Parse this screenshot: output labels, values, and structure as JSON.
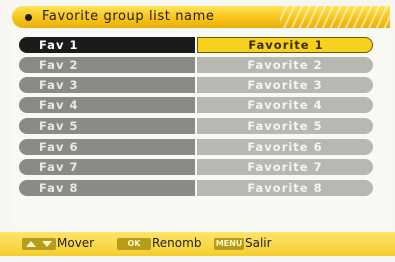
{
  "header": {
    "title": "Favorite group list name"
  },
  "rows": [
    {
      "group": "Fav 1",
      "name": "Favorite 1",
      "selected": true
    },
    {
      "group": "Fav 2",
      "name": "Favorite 2",
      "selected": false
    },
    {
      "group": "Fav 3",
      "name": "Favorite 3",
      "selected": false
    },
    {
      "group": "Fav 4",
      "name": "Favorite 4",
      "selected": false
    },
    {
      "group": "Fav 5",
      "name": "Favorite 5",
      "selected": false
    },
    {
      "group": "Fav 6",
      "name": "Favorite 6",
      "selected": false
    },
    {
      "group": "Fav 7",
      "name": "Favorite 7",
      "selected": false
    },
    {
      "group": "Fav 8",
      "name": "Favorite 8",
      "selected": false
    }
  ],
  "footer": {
    "move_key": "arrow-up-down-icon",
    "move_label": "Mover",
    "ok_key": "OK",
    "ok_label": "Renomb",
    "menu_key": "MENU",
    "menu_label": "Salir"
  },
  "colors": {
    "accent": "#f8c31a",
    "selected_row": "#1b1b1b",
    "selected_name": "#f7d11e",
    "row_left": "#8a8a86",
    "row_right": "#b8b8b2"
  }
}
